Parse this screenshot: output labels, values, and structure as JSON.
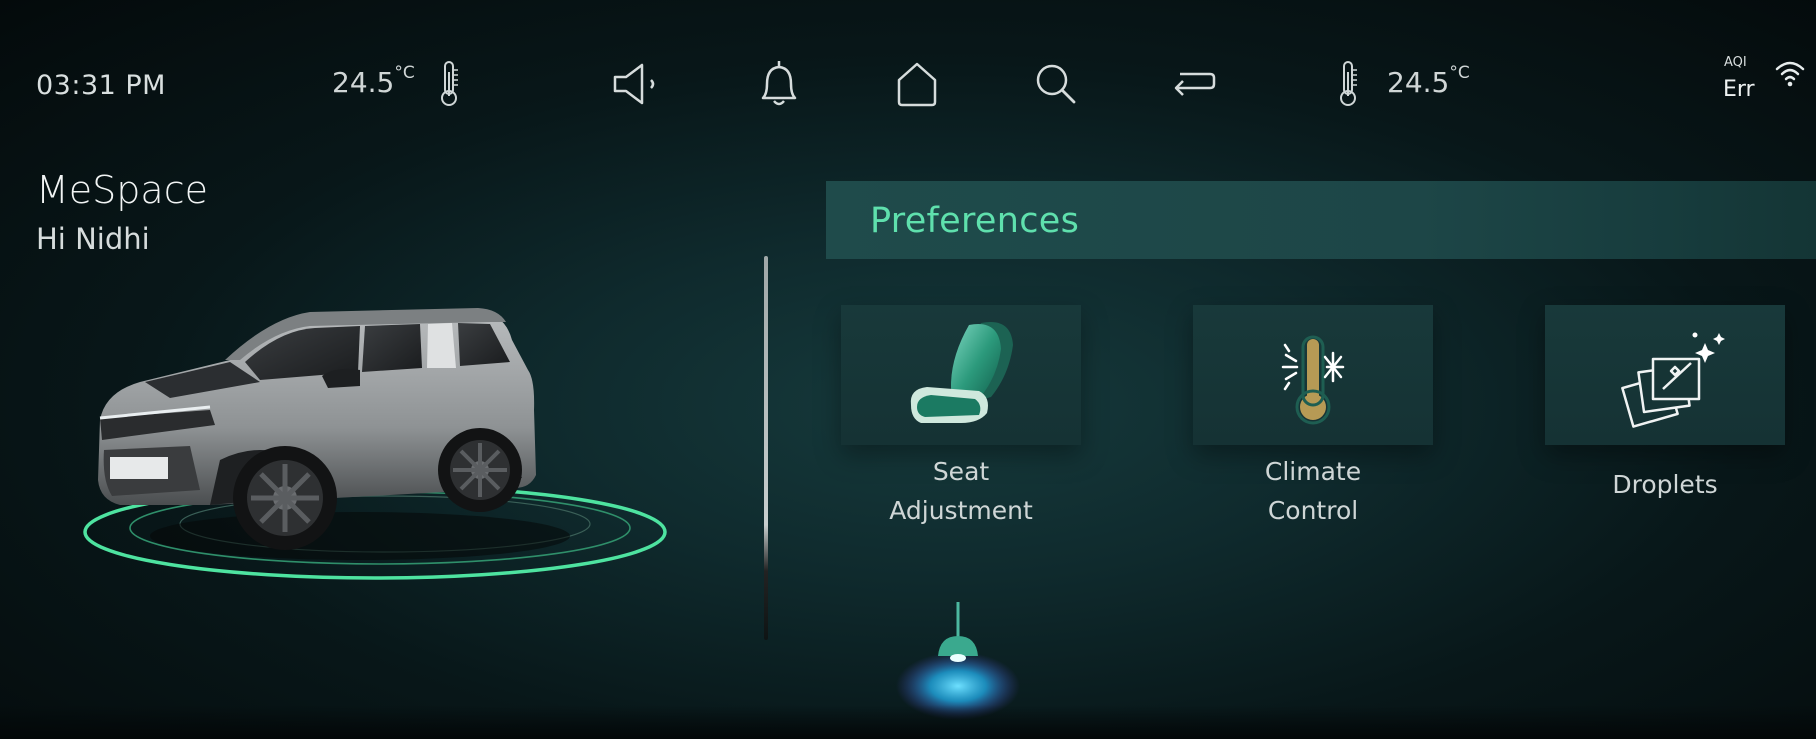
{
  "status_bar": {
    "time": "03:31 PM",
    "temp_left": "24.5",
    "temp_left_unit": "°C",
    "temp_right": "24.5",
    "temp_right_unit": "°C",
    "aqi_label": "AQI",
    "aqi_value": "Err",
    "icons": [
      "volume-icon",
      "bell-icon",
      "home-icon",
      "search-icon",
      "back-icon",
      "thermometer-icon",
      "wifi-icon"
    ]
  },
  "header": {
    "app_name": "MeSpace",
    "greeting": "Hi Nidhi"
  },
  "preferences": {
    "title": "Preferences",
    "tiles": [
      {
        "label_line1": "Seat",
        "label_line2": "Adjustment",
        "icon": "seat-icon"
      },
      {
        "label_line1": "Climate",
        "label_line2": "Control",
        "icon": "climate-thermometer-icon"
      },
      {
        "label_line1": "Droplets",
        "label_line2": "",
        "icon": "droplets-cards-icon"
      }
    ],
    "partial_tile_icon": "ambient-lamp-icon"
  },
  "colors": {
    "accent_green": "#5fe0ad",
    "panel": "#1f4b4b",
    "background": "#0f2a2d",
    "ring": "#4ee3a0"
  }
}
